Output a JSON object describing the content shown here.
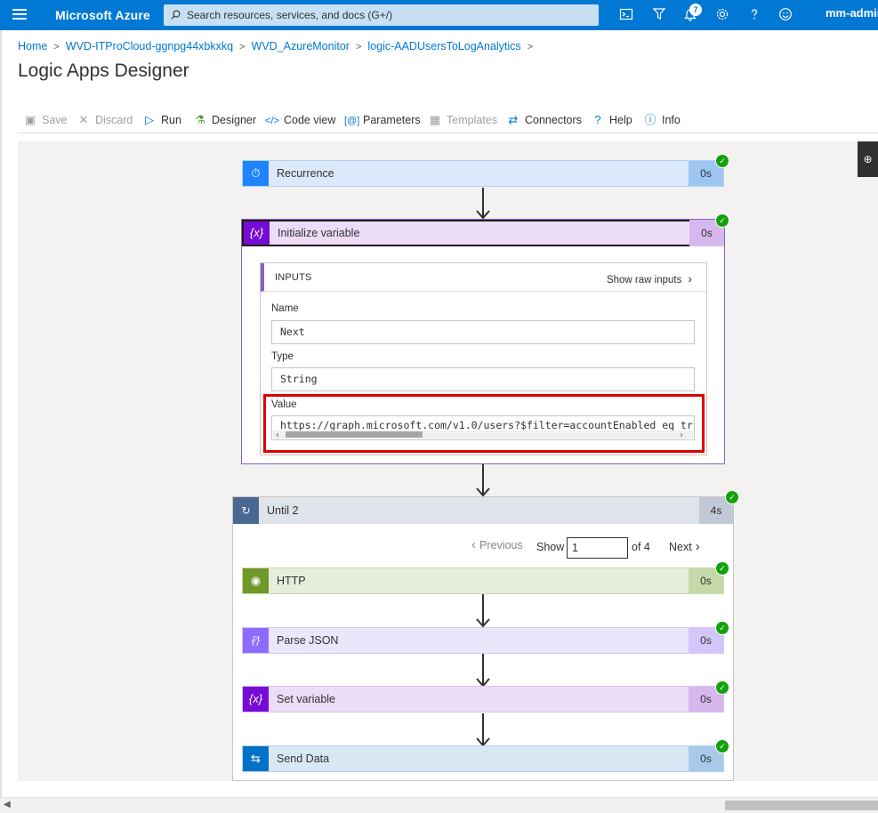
{
  "topbar": {
    "brand": "Microsoft Azure",
    "search_placeholder": "Search resources, services, and docs (G+/)",
    "notification_count": "7",
    "user": "mm-admin"
  },
  "breadcrumb": [
    "Home",
    "WVD-ITProCloud-ggnpg44xbkxkq",
    "WVD_AzureMonitor",
    "logic-AADUsersToLogAnalytics"
  ],
  "page_title": "Logic Apps Designer",
  "toolbar": {
    "save": "Save",
    "discard": "Discard",
    "run": "Run",
    "designer": "Designer",
    "code_view": "Code view",
    "parameters": "Parameters",
    "templates": "Templates",
    "connectors": "Connectors",
    "help": "Help",
    "info": "Info"
  },
  "steps": {
    "recurrence": {
      "label": "Recurrence",
      "duration": "0s",
      "color": "#1f85ff"
    },
    "init_variable": {
      "label": "Initialize variable",
      "duration": "0s",
      "color": "#770bd6"
    },
    "until": {
      "label": "Until 2",
      "duration": "4s",
      "color": "#486991"
    },
    "http": {
      "label": "HTTP",
      "duration": "0s",
      "color": "#709727"
    },
    "parse_json": {
      "label": "Parse JSON",
      "duration": "0s",
      "color": "#8c6cff"
    },
    "set_variable": {
      "label": "Set variable",
      "duration": "0s",
      "color": "#770bd6"
    },
    "send_data": {
      "label": "Send Data",
      "duration": "0s",
      "color": "#0072c6"
    }
  },
  "inputs": {
    "header": "INPUTS",
    "show_raw": "Show raw inputs",
    "name_label": "Name",
    "name_value": "Next",
    "type_label": "Type",
    "type_value": "String",
    "value_label": "Value",
    "value_value": "https://graph.microsoft.com/v1.0/users?$filter=accountEnabled eq tr"
  },
  "pager": {
    "previous": "Previous",
    "show": "Show",
    "current": "1",
    "of": "of 4",
    "next": "Next"
  }
}
